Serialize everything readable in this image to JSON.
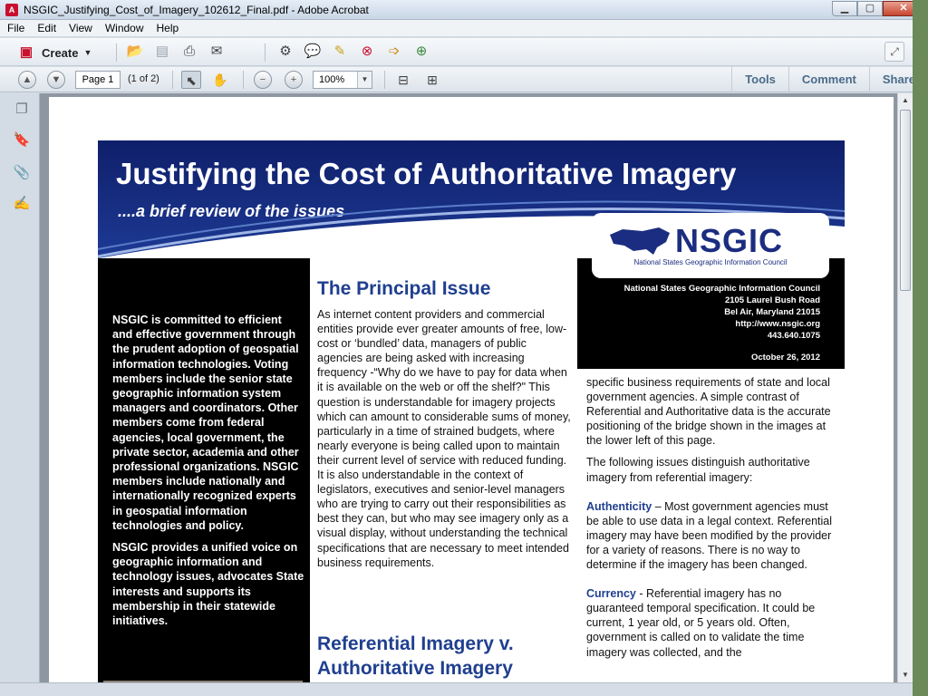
{
  "window": {
    "title": "NSGIC_Justifying_Cost_of_Imagery_102612_Final.pdf - Adobe Acrobat"
  },
  "menu": {
    "items": [
      "File",
      "Edit",
      "View",
      "Window",
      "Help"
    ],
    "close_glyph": "×"
  },
  "toolbar": {
    "create_label": "Create"
  },
  "nav": {
    "page_value": "Page 1",
    "page_of": "(1 of 2)",
    "zoom_value": "100%",
    "links": [
      "Tools",
      "Comment",
      "Share"
    ]
  },
  "doc": {
    "title": "Justifying the Cost of Authoritative Imagery",
    "subtitle": "....a brief review of the issues",
    "logo_word": "NSGIC",
    "logo_caption": "National States Geographic Information Council",
    "address": [
      "National States Geographic Information Council",
      "2105 Laurel Bush Road",
      "Bel Air, Maryland 21015",
      "http://www.nsgic.org",
      "443.640.1075"
    ],
    "date": "October 26, 2012",
    "left_para1": "NSGIC is committed to efficient and effective government through the prudent adoption of geospatial information technologies. Voting members include the senior state geographic information system managers and coordinators. Other members come from federal agencies, local government, the private sector, academia and other professional organizations. NSGIC members include nationally and internationally recognized experts in geospatial information technologies and policy.",
    "left_para2": "NSGIC provides a unified voice on geographic information and technology issues, advocates State interests and supports its membership in their statewide initiatives.",
    "principal_heading": "The Principal Issue",
    "principal_text": "As internet content providers and commercial entities provide ever greater amounts of free, low-cost or ‘bundled’ data, managers of public agencies are being asked with increasing frequency -“Why do we have to pay for data when it is available on the web or off the shelf?\"  This question is understandable for imagery projects which can amount to considerable sums of money, particularly in a time of strained budgets, where nearly everyone is being called upon to maintain their current level of service with reduced funding.  It is also understandable in the context of legislators, executives and senior-level managers who are trying to carry out their responsibilities as best they can, but who may see imagery only as a visual display, without understanding the technical specifications that are necessary to meet intended business requirements.",
    "referential_heading": "Referential Imagery v. Authoritative Imagery",
    "right_para1": "specific business requirements of state and local government agencies.  A simple contrast of Referential and Authoritative data is the accurate positioning of the bridge shown in the images at the lower left of this page.",
    "right_para2": "The following issues distinguish authoritative imagery from referential imagery:",
    "authenticity_kw": "Authenticity",
    "authenticity_text": " – Most government agencies must be able to use data in a legal context.  Referential imagery may have been modified by the provider for a variety of reasons.  There is no way to determine if the imagery has been changed.",
    "currency_kw": "Currency",
    "currency_text": " - Referential imagery has no guaranteed temporal specification.  It could be current, 1 year old, or 5 years old. Often,  government is called on to validate the time imagery was collected, and the"
  }
}
